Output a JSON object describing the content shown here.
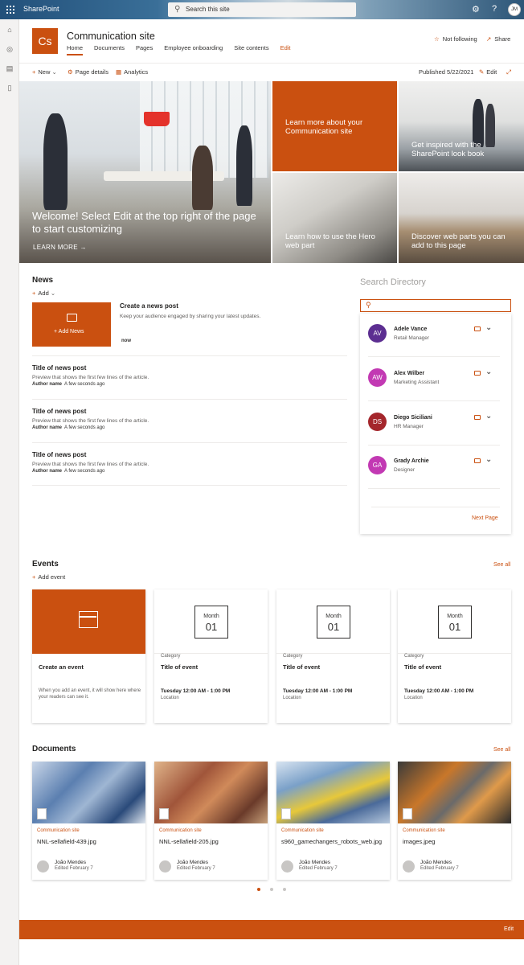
{
  "suite": {
    "app_name": "SharePoint",
    "search_placeholder": "Search this site",
    "user_initials": "JM"
  },
  "site": {
    "logo_text": "Cs",
    "title": "Communication site",
    "nav": [
      "Home",
      "Documents",
      "Pages",
      "Employee onboarding",
      "Site contents",
      "Edit"
    ],
    "follow_label": "Not following",
    "share_label": "Share"
  },
  "command_bar": {
    "new_label": "New",
    "page_details_label": "Page details",
    "analytics_label": "Analytics",
    "published_label": "Published 5/22/2021",
    "edit_label": "Edit"
  },
  "hero": {
    "main_title": "Welcome! Select Edit at the top right of the page to start customizing",
    "main_link": "LEARN MORE",
    "tiles": [
      "Learn more about your Communication site",
      "Get inspired with the SharePoint look book",
      "Learn how to use the Hero web part",
      "Discover web parts you can add to this page"
    ]
  },
  "news": {
    "heading": "News",
    "add_label": "Add",
    "add_news_label": "Add News",
    "create_title": "Create a news post",
    "create_desc": "Keep your audience engaged by sharing your latest updates.",
    "create_time": "now",
    "items": [
      {
        "title": "Title of news post",
        "preview": "Preview that shows the first few lines of the article.",
        "author": "Author name",
        "time": "A few seconds ago"
      },
      {
        "title": "Title of news post",
        "preview": "Preview that shows the first few lines of the article.",
        "author": "Author name",
        "time": "A few seconds ago"
      },
      {
        "title": "Title of news post",
        "preview": "Preview that shows the first few lines of the article.",
        "author": "Author name",
        "time": "A few seconds ago"
      }
    ]
  },
  "directory": {
    "title": "Search Directory",
    "people": [
      {
        "initials": "AV",
        "name": "Adele Vance",
        "role": "Retail Manager",
        "color": "#5c2e91"
      },
      {
        "initials": "AW",
        "name": "Alex Wilber",
        "role": "Marketing Assistant",
        "color": "#c239b3"
      },
      {
        "initials": "DS",
        "name": "Diego Siciliani",
        "role": "HR Manager",
        "color": "#a4262c"
      },
      {
        "initials": "GA",
        "name": "Grady Archie",
        "role": "Designer",
        "color": "#c239b3"
      }
    ],
    "next_page": "Next Page"
  },
  "events": {
    "heading": "Events",
    "see_all": "See all",
    "add_label": "Add event",
    "create_title": "Create an event",
    "create_desc": "When you add an event, it will show here where your readers can see it.",
    "cards": [
      {
        "month": "Month",
        "day": "01",
        "category": "Category",
        "title": "Title of event",
        "time": "Tuesday 12:00 AM - 1:00 PM",
        "location": "Location"
      },
      {
        "month": "Month",
        "day": "01",
        "category": "Category",
        "title": "Title of event",
        "time": "Tuesday 12:00 AM - 1:00 PM",
        "location": "Location"
      },
      {
        "month": "Month",
        "day": "01",
        "category": "Category",
        "title": "Title of event",
        "time": "Tuesday 12:00 AM - 1:00 PM",
        "location": "Location"
      }
    ]
  },
  "documents": {
    "heading": "Documents",
    "see_all": "See all",
    "cards": [
      {
        "site": "Communication site",
        "name": "NNL-sellafield-439.jpg",
        "author": "João Mendes",
        "edited": "Edited February 7"
      },
      {
        "site": "Communication site",
        "name": "NNL-sellafield-205.jpg",
        "author": "João Mendes",
        "edited": "Edited February 7"
      },
      {
        "site": "Communication site",
        "name": "s960_gamechangers_robots_web.jpg",
        "author": "João Mendes",
        "edited": "Edited February 7"
      },
      {
        "site": "Communication site",
        "name": "images.jpeg",
        "author": "João Mendes",
        "edited": "Edited February 7"
      }
    ]
  },
  "footer": {
    "edit_label": "Edit"
  },
  "colors": {
    "accent": "#ca5010"
  }
}
